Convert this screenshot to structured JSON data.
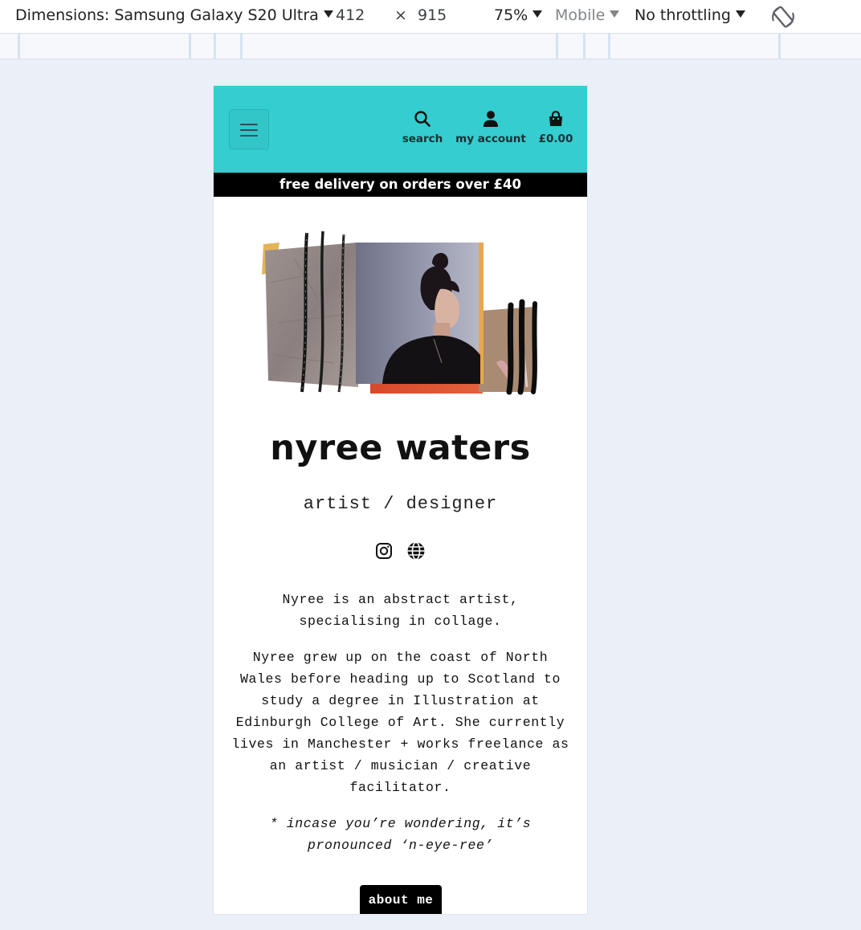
{
  "devtools": {
    "dimensions_label": "Dimensions: Samsung Galaxy S20 Ultra",
    "width": "412",
    "times": "×",
    "height": "915",
    "zoom": "75%",
    "device_type": "Mobile",
    "throttling": "No throttling",
    "rotate_icon": "rotate-icon"
  },
  "header": {
    "menu_icon": "hamburger-icon",
    "nav": [
      {
        "label": "search",
        "icon": "search-icon"
      },
      {
        "label": "my account",
        "icon": "user-icon"
      },
      {
        "label": "£0.00",
        "icon": "bag-icon"
      }
    ],
    "background_color": "#34cdd0"
  },
  "promo_banner": "free delivery on orders over £40",
  "profile": {
    "name": "nyree waters",
    "role": "artist / designer",
    "socials": [
      {
        "icon": "instagram-icon"
      },
      {
        "icon": "globe-icon"
      }
    ],
    "bio_intro": "Nyree is an abstract artist, specialising in collage.",
    "bio_body": "Nyree grew up on the coast of North Wales before heading up to Scotland to study a degree in Illustration at Edinburgh College of Art. She currently lives in Manchester + works freelance as an artist / musician / creative facilitator.",
    "pronunciation": "* incase you’re wondering, it’s pronounced ‘n-eye-ree’",
    "about_button": "about me"
  }
}
